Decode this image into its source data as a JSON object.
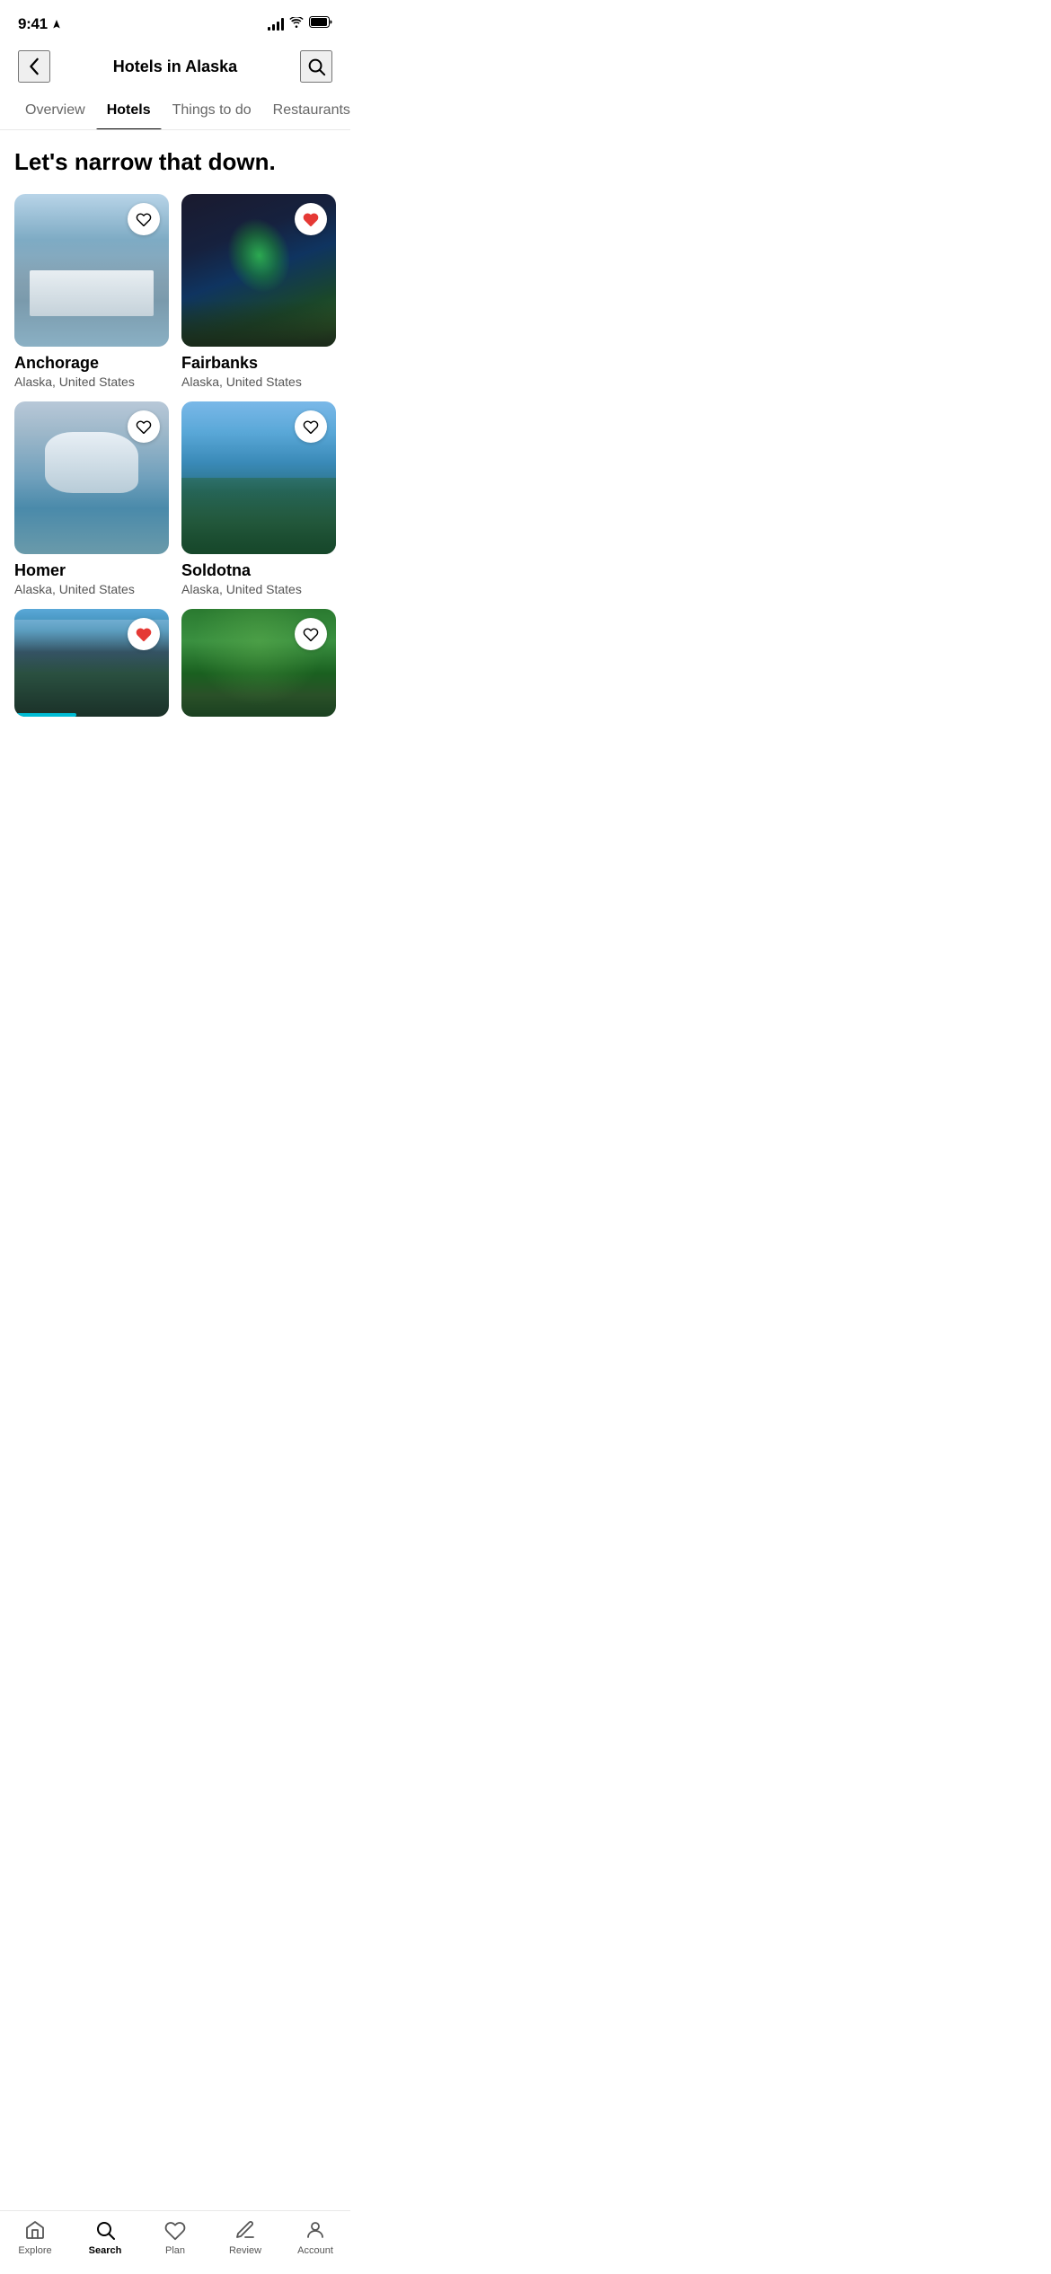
{
  "statusBar": {
    "time": "9:41",
    "locationArrow": true
  },
  "header": {
    "title": "Hotels in Alaska",
    "backLabel": "Back",
    "searchLabel": "Search"
  },
  "tabs": [
    {
      "id": "overview",
      "label": "Overview",
      "active": false
    },
    {
      "id": "hotels",
      "label": "Hotels",
      "active": true
    },
    {
      "id": "things-to-do",
      "label": "Things to do",
      "active": false
    },
    {
      "id": "restaurants",
      "label": "Restaurants",
      "active": false
    }
  ],
  "sectionTitle": "Let's narrow that down.",
  "cards": [
    {
      "id": "anchorage",
      "name": "Anchorage",
      "subtitle": "Alaska, United States",
      "favorited": false,
      "imgClass": "img-anchorage"
    },
    {
      "id": "fairbanks",
      "name": "Fairbanks",
      "subtitle": "Alaska, United States",
      "favorited": true,
      "imgClass": "img-fairbanks"
    },
    {
      "id": "homer",
      "name": "Homer",
      "subtitle": "Alaska, United States",
      "favorited": false,
      "imgClass": "img-homer"
    },
    {
      "id": "soldotna",
      "name": "Soldotna",
      "subtitle": "Alaska, United States",
      "favorited": false,
      "imgClass": "img-soldotna"
    },
    {
      "id": "card5",
      "name": "",
      "subtitle": "",
      "favorited": true,
      "imgClass": "img-card5"
    },
    {
      "id": "card6",
      "name": "",
      "subtitle": "",
      "favorited": false,
      "imgClass": "img-card6"
    }
  ],
  "bottomNav": [
    {
      "id": "explore",
      "label": "Explore",
      "active": false,
      "icon": "home"
    },
    {
      "id": "search",
      "label": "Search",
      "active": true,
      "icon": "search"
    },
    {
      "id": "plan",
      "label": "Plan",
      "active": false,
      "icon": "heart"
    },
    {
      "id": "review",
      "label": "Review",
      "active": false,
      "icon": "pencil"
    },
    {
      "id": "account",
      "label": "Account",
      "active": false,
      "icon": "person"
    }
  ]
}
